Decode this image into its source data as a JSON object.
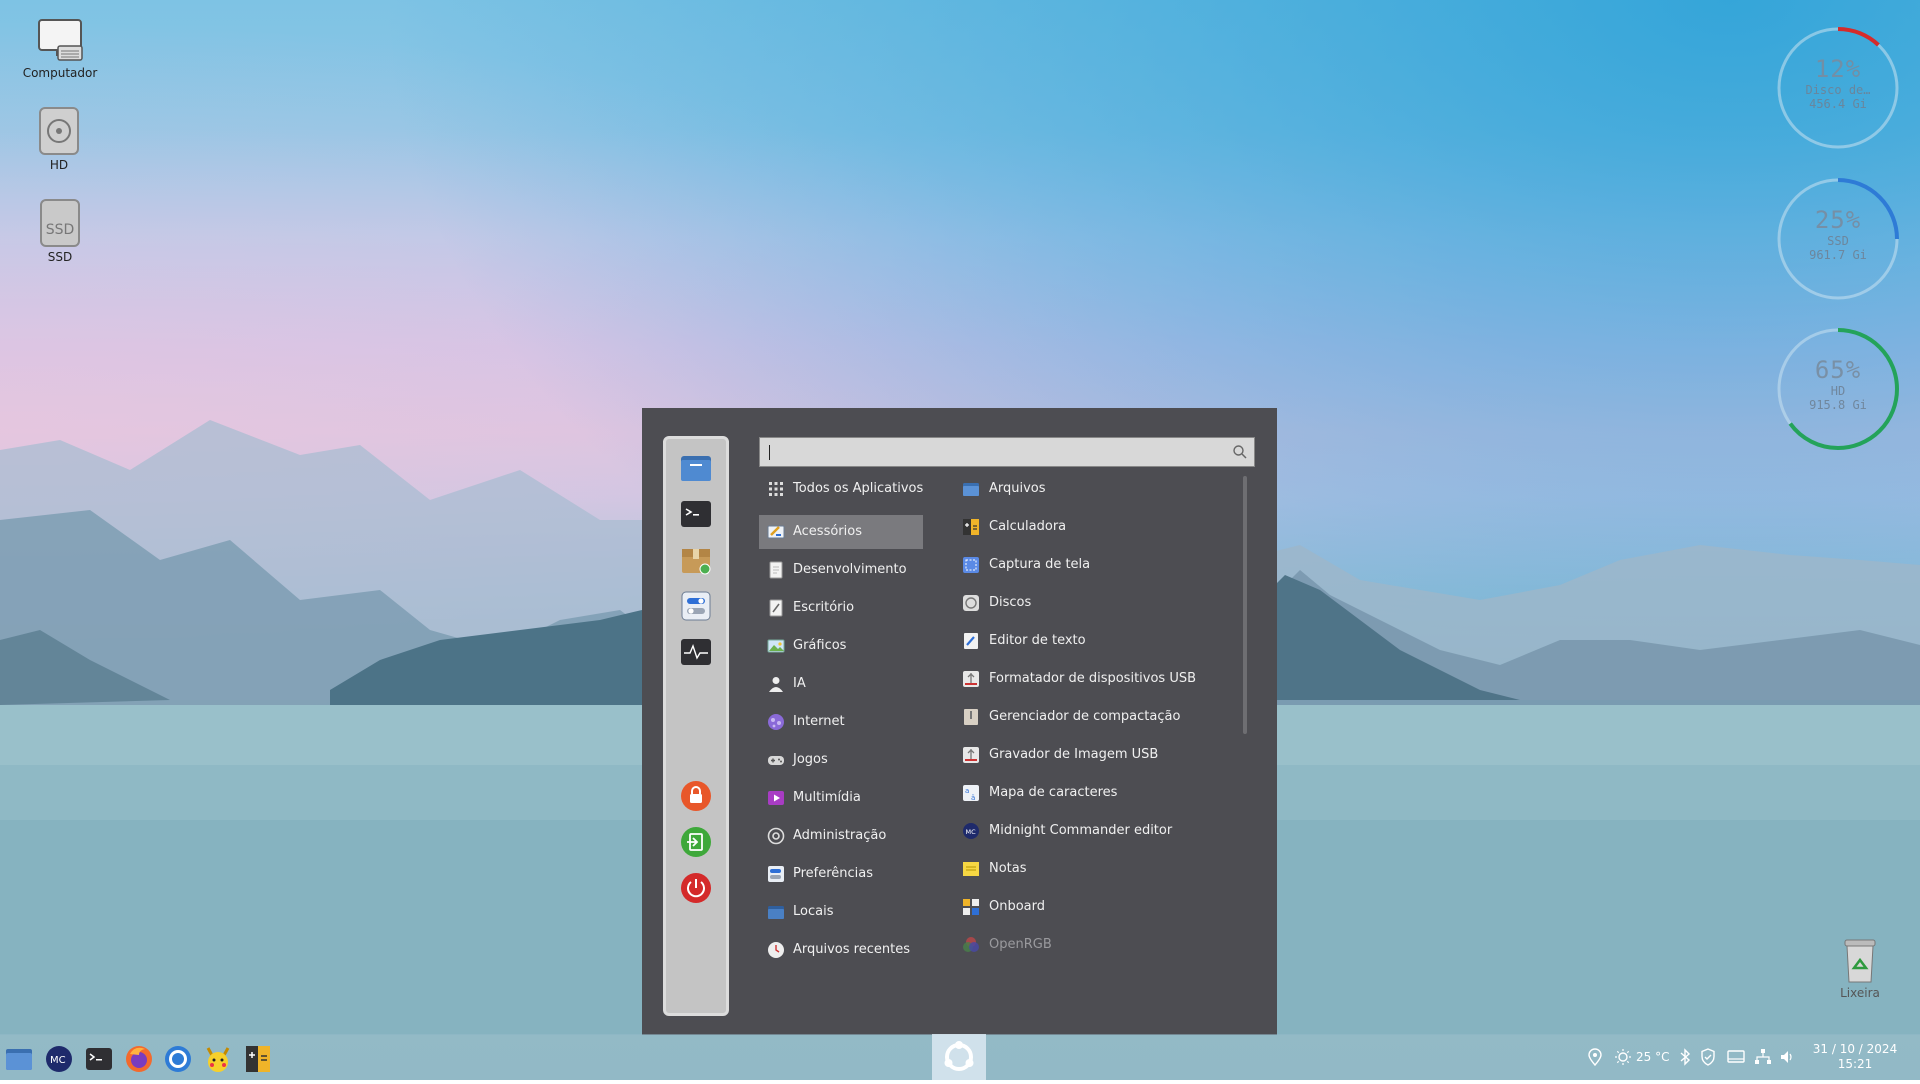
{
  "desktop_icons": [
    {
      "label": "Computador",
      "icon": "computer-icon"
    },
    {
      "label": "HD",
      "icon": "hard-drive-icon"
    },
    {
      "label": "SSD",
      "icon": "ssd-icon"
    },
    {
      "label": "Lixeira",
      "icon": "trash-icon"
    }
  ],
  "disk_widgets": [
    {
      "percent": "12%",
      "name": "Disco de…",
      "size": "456.4 Gi",
      "fraction": 0.12,
      "color": "#d62b2b"
    },
    {
      "percent": "25%",
      "name": "SSD",
      "size": "961.7 Gi",
      "fraction": 0.25,
      "color": "#2e7bd6"
    },
    {
      "percent": "65%",
      "name": "HD",
      "size": "915.8 Gi",
      "fraction": 0.65,
      "color": "#24a35a"
    }
  ],
  "menu": {
    "search_value": "",
    "favorites": [
      {
        "icon": "files-icon"
      },
      {
        "icon": "terminal-icon"
      },
      {
        "icon": "package-icon"
      },
      {
        "icon": "settings-icon"
      },
      {
        "icon": "system-monitor-icon"
      }
    ],
    "session": [
      {
        "icon": "lock-icon",
        "color": "#e8572a"
      },
      {
        "icon": "logout-icon",
        "color": "#3ea83a"
      },
      {
        "icon": "power-icon",
        "color": "#d42a2a"
      }
    ],
    "categories": [
      {
        "label": "Todos os Aplicativos",
        "icon": "grid-icon"
      },
      {
        "label": "Acessórios",
        "icon": "accessories-icon",
        "selected": true
      },
      {
        "label": "Desenvolvimento",
        "icon": "development-icon"
      },
      {
        "label": "Escritório",
        "icon": "office-icon"
      },
      {
        "label": "Gráficos",
        "icon": "graphics-icon"
      },
      {
        "label": "IA",
        "icon": "ai-icon"
      },
      {
        "label": "Internet",
        "icon": "internet-icon"
      },
      {
        "label": "Jogos",
        "icon": "games-icon"
      },
      {
        "label": "Multimídia",
        "icon": "multimedia-icon"
      },
      {
        "label": "Administração",
        "icon": "administration-icon"
      },
      {
        "label": "Preferências",
        "icon": "preferences-icon"
      },
      {
        "label": "Locais",
        "icon": "places-icon"
      },
      {
        "label": "Arquivos recentes",
        "icon": "recent-files-icon"
      }
    ],
    "apps": [
      {
        "label": "Arquivos",
        "icon": "files-icon"
      },
      {
        "label": "Calculadora",
        "icon": "calculator-icon"
      },
      {
        "label": "Captura de tela",
        "icon": "screenshot-icon"
      },
      {
        "label": "Discos",
        "icon": "disks-icon"
      },
      {
        "label": "Editor de texto",
        "icon": "text-editor-icon"
      },
      {
        "label": "Formatador de dispositivos USB",
        "icon": "usb-format-icon"
      },
      {
        "label": "Gerenciador de compactação",
        "icon": "archive-icon"
      },
      {
        "label": "Gravador de Imagem USB",
        "icon": "usb-writer-icon"
      },
      {
        "label": "Mapa de caracteres",
        "icon": "charmap-icon"
      },
      {
        "label": "Midnight Commander editor",
        "icon": "mc-icon"
      },
      {
        "label": "Notas",
        "icon": "notes-icon"
      },
      {
        "label": "Onboard",
        "icon": "keyboard-icon"
      },
      {
        "label": "OpenRGB",
        "icon": "openrgb-icon",
        "dimmed": true
      }
    ]
  },
  "taskbar": {
    "launchers": [
      {
        "icon": "files-icon"
      },
      {
        "icon": "mc-icon"
      },
      {
        "icon": "terminal-icon"
      },
      {
        "icon": "firefox-icon"
      },
      {
        "icon": "chrome-icon"
      },
      {
        "icon": "pikachu-icon"
      },
      {
        "icon": "calculator-icon"
      }
    ],
    "tray": {
      "temperature": "25 °C",
      "date": "31 / 10 / 2024",
      "time": "15:21"
    }
  }
}
